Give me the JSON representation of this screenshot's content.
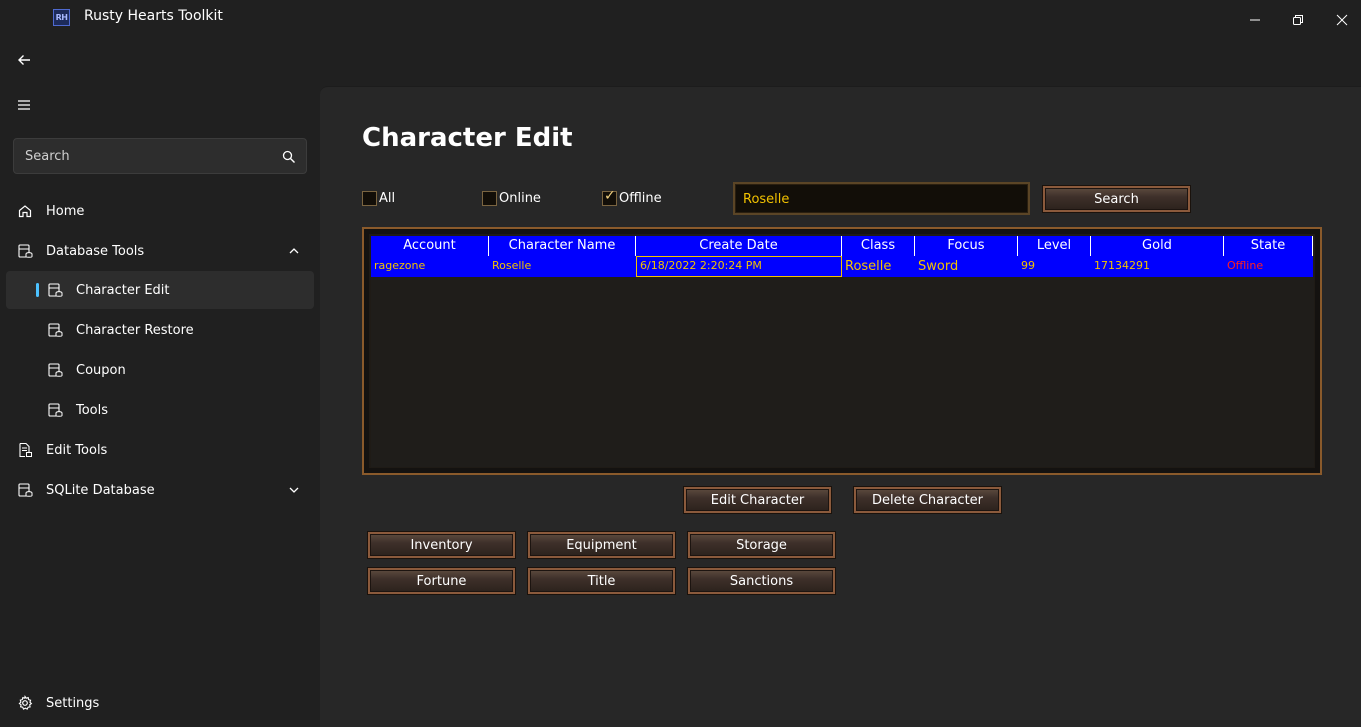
{
  "app": {
    "title": "Rusty Hearts Toolkit",
    "logo_text": "RH"
  },
  "window_controls": {
    "minimize_icon": "minimize-icon",
    "maximize_icon": "restore-icon",
    "close_icon": "close-icon"
  },
  "sidebar": {
    "search_placeholder": "Search",
    "items": [
      {
        "label": "Home",
        "icon": "home-icon"
      },
      {
        "label": "Database Tools",
        "icon": "database-icon",
        "expanded": true
      },
      {
        "label": "Character Edit",
        "icon": "table-icon",
        "selected": true
      },
      {
        "label": "Character Restore",
        "icon": "table-icon"
      },
      {
        "label": "Coupon",
        "icon": "table-icon"
      },
      {
        "label": "Tools",
        "icon": "table-icon"
      },
      {
        "label": "Edit Tools",
        "icon": "document-icon"
      },
      {
        "label": "SQLite Database",
        "icon": "database-icon",
        "expanded": false
      }
    ],
    "settings_label": "Settings"
  },
  "main": {
    "title": "Character Edit",
    "filters": {
      "all": "All",
      "online": "Online",
      "offline": "Offline",
      "offline_checked": true
    },
    "search_value": "Roselle",
    "search_button": "Search",
    "grid": {
      "columns": [
        "Account",
        "Character Name",
        "Create Date",
        "Class",
        "Focus",
        "Level",
        "Gold",
        "State"
      ],
      "rows": [
        {
          "account": "ragezone",
          "character_name": "Roselle",
          "create_date": "6/18/2022 2:20:24 PM",
          "class": "Roselle",
          "focus": "Sword",
          "level": "99",
          "gold": "17134291",
          "state": "Offline"
        }
      ]
    },
    "buttons": {
      "edit_character": "Edit Character",
      "delete_character": "Delete Character",
      "inventory": "Inventory",
      "equipment": "Equipment",
      "storage": "Storage",
      "fortune": "Fortune",
      "title": "Title",
      "sanctions": "Sanctions"
    }
  },
  "colors": {
    "grid_row_bg": "#0000ff",
    "cell_text": "#f2c200",
    "state_offline": "#ff2020",
    "accent": "#4cc2ff",
    "frame_border": "#8a5a2b"
  }
}
